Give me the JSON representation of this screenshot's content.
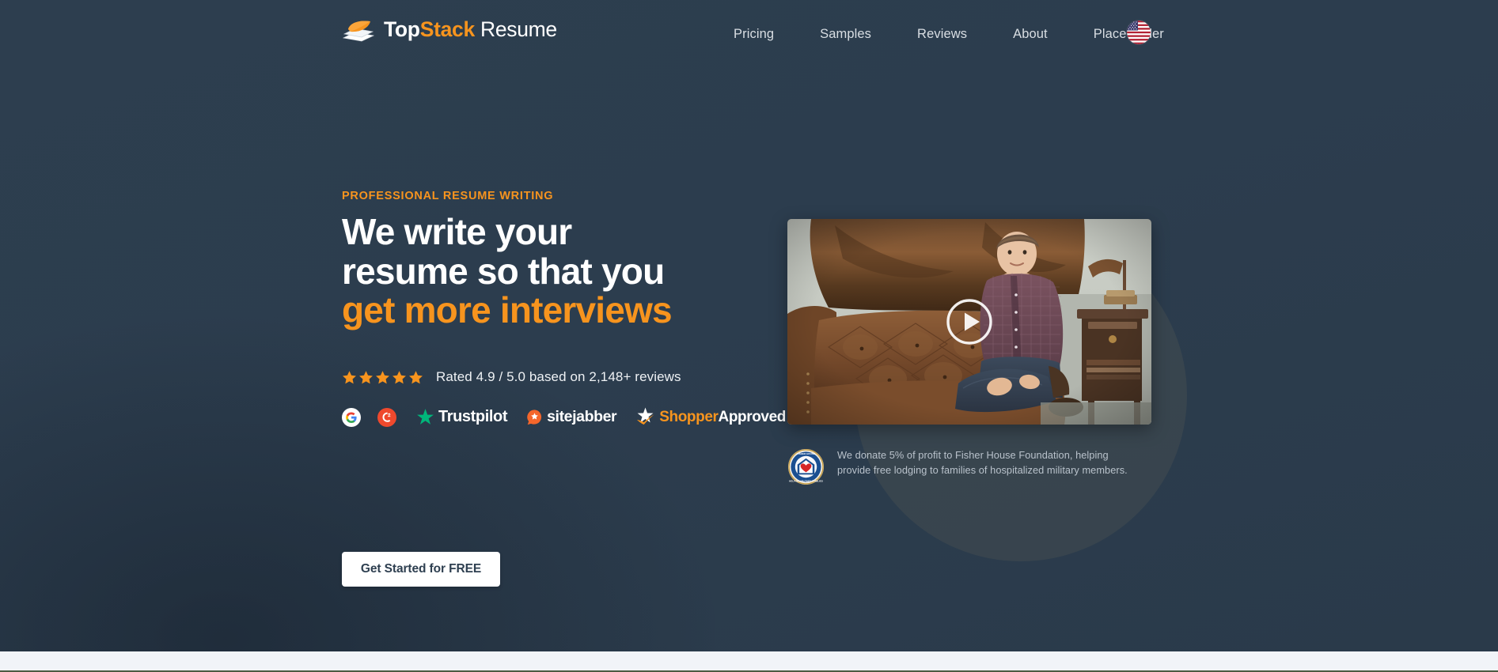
{
  "brand": {
    "logo_icon": "stacked-papers-icon",
    "name_part1": "Top",
    "name_part2": "Stack",
    "name_part3": " Resume",
    "accent_color": "#f7941e",
    "background_color": "#2e3f50"
  },
  "nav": {
    "items": [
      {
        "label": "Pricing",
        "name": "pricing"
      },
      {
        "label": "Samples",
        "name": "samples"
      },
      {
        "label": "Reviews",
        "name": "reviews"
      },
      {
        "label": "About",
        "name": "about"
      },
      {
        "label": "Place Order",
        "name": "place-order"
      }
    ],
    "locale_icon": "us-flag-icon"
  },
  "hero": {
    "eyebrow": "PROFESSIONAL RESUME WRITING",
    "headline_line1": "We write your",
    "headline_line2": "resume so that you",
    "headline_accent": "get more interviews",
    "cta_label": "Get Started for FREE"
  },
  "rating": {
    "stars_count": 5,
    "star_icon": "star-icon",
    "text": "Rated 4.9 / 5.0 based on 2,148+ reviews",
    "score": "4.9",
    "scale": "5.0",
    "review_count": "2,148+"
  },
  "review_badges": [
    {
      "name": "google",
      "label": "",
      "icon": "google-g-icon"
    },
    {
      "name": "g2",
      "label": "",
      "icon": "g2-icon"
    },
    {
      "name": "trustpilot",
      "label": "Trustpilot",
      "icon": "trustpilot-star-icon"
    },
    {
      "name": "sitejabber",
      "label": "sitejabber",
      "icon": "sitejabber-icon"
    },
    {
      "name": "shopper-approved",
      "label_orange": "Shopper",
      "label_white": "Approved",
      "icon": "shopper-approved-star-icon"
    }
  ],
  "video": {
    "alt": "Man seated on brown leather Chesterfield sofa in an office",
    "play_icon": "play-button-icon"
  },
  "donation": {
    "seal_icon": "fisher-house-seal-icon",
    "text": "We donate 5% of profit to Fisher House Foundation, helping provide free lodging to families of hospitalized military members."
  }
}
